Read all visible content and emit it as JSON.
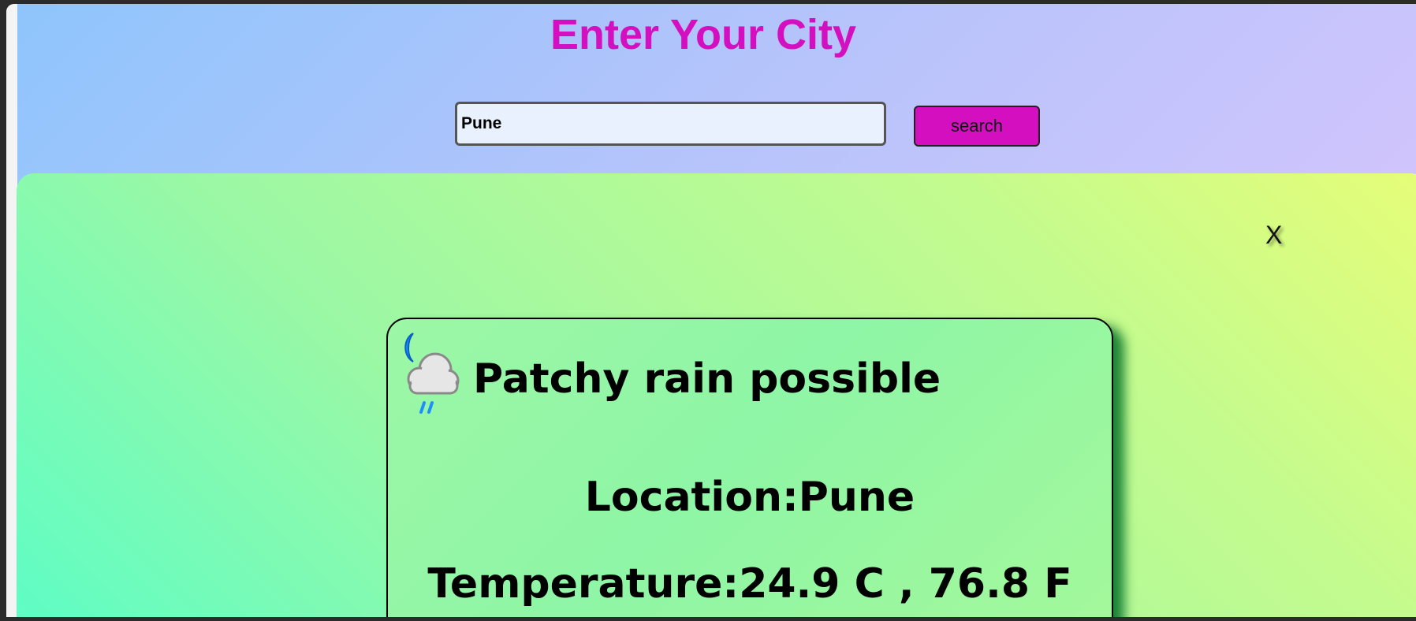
{
  "header": {
    "title": "Enter Your City"
  },
  "search": {
    "value": "Pune",
    "button_label": "search"
  },
  "result": {
    "close_label": "X",
    "weather_icon": "moon-cloud-rain-icon",
    "condition": "Patchy rain possible",
    "location_label": "Location:",
    "location_value": "Pune",
    "temperature_label": "Temperature:",
    "temperature_value": "24.9 C , 76.8 F"
  },
  "colors": {
    "title": "#d30fc0",
    "button": "#d30fc0",
    "card_shadow": "#006e28"
  }
}
